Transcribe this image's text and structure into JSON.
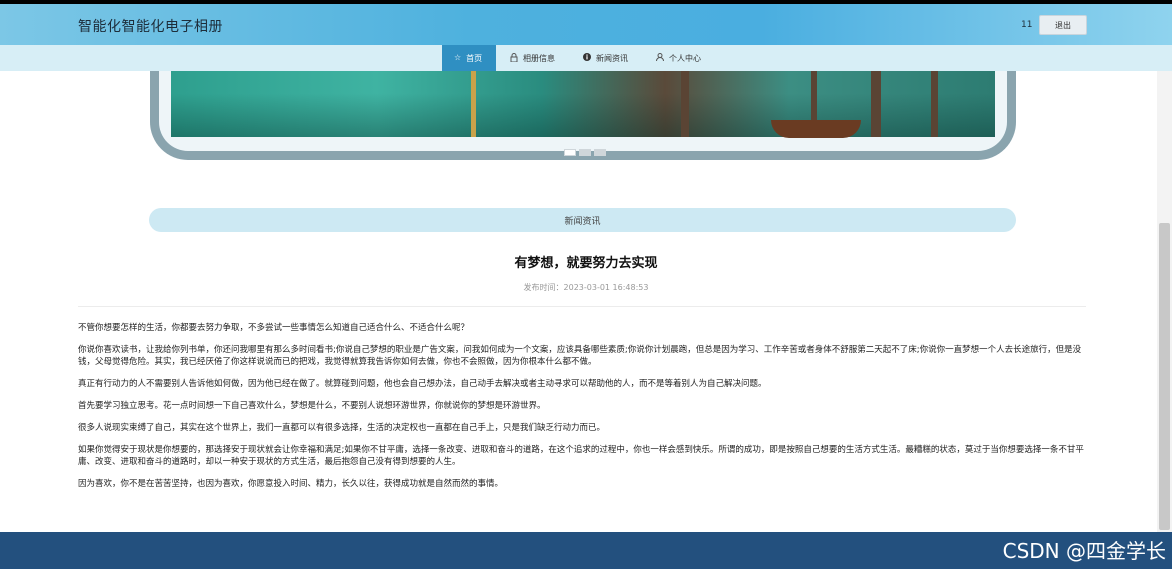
{
  "header": {
    "site_title": "智能化智能化电子相册",
    "user_name": "11",
    "logout_label": "退出"
  },
  "nav": {
    "items": [
      {
        "label": "首页",
        "icon": "star-icon",
        "glyph": "☆"
      },
      {
        "label": "相册信息",
        "icon": "lock-icon",
        "glyph": "🔒"
      },
      {
        "label": "新闻资讯",
        "icon": "info-icon",
        "glyph": "❶"
      },
      {
        "label": "个人中心",
        "icon": "user-icon",
        "glyph": "👤"
      }
    ],
    "active_index": 0
  },
  "carousel": {
    "slide_count": 3,
    "active_index": 0
  },
  "section": {
    "banner_label": "新闻资讯"
  },
  "article": {
    "title": "有梦想，就要努力去实现",
    "publish_time": "发布时间：2023-03-01 16:48:53",
    "paragraphs": [
      "不管你想要怎样的生活，你都要去努力争取，不多尝试一些事情怎么知道自己适合什么、不适合什么呢？",
      "你说你喜欢读书，让我给你列书单，你还问我哪里有那么多时间看书;你说自己梦想的职业是广告文案，问我如何成为一个文案，应该具备哪些素质;你说你计划晨跑，但总是因为学习、工作辛苦或者身体不舒服第二天起不了床;你说你一直梦想一个人去长途旅行，但是没钱，父母觉得危险。其实，我已经厌倦了你这样说说而已的把戏，我觉得就算我告诉你如何去做，你也不会照做，因为你根本什么都不做。",
      "真正有行动力的人不需要别人告诉他如何做，因为他已经在做了。就算碰到问题，他也会自己想办法，自己动手去解决或者主动寻求可以帮助他的人，而不是等着别人为自己解决问题。",
      "首先要学习独立思考。花一点时间想一下自己喜欢什么，梦想是什么，不要别人说想环游世界，你就说你的梦想是环游世界。",
      "很多人说现实束缚了自己，其实在这个世界上，我们一直都可以有很多选择，生活的决定权也一直都在自己手上，只是我们缺乏行动力而已。",
      "如果你觉得安于现状是你想要的，那选择安于现状就会让你幸福和满足;如果你不甘平庸，选择一条改变、进取和奋斗的道路，在这个追求的过程中，你也一样会感到快乐。所谓的成功，即是按照自己想要的生活方式生活。最糟糕的状态，莫过于当你想要选择一条不甘平庸、改变、进取和奋斗的道路时，却以一种安于现状的方式生活，最后抱怨自己没有得到想要的人生。",
      "因为喜欢，你不是在苦苦坚持，也因为喜欢，你愿意投入时间、精力，长久以往，获得成功就是自然而然的事情。"
    ]
  },
  "watermark": "CSDN @四金学长",
  "colors": {
    "header_blue": "#4aaee0",
    "nav_active": "#2f8fc2",
    "footer": "#23507e",
    "banner": "#cde9f3"
  }
}
